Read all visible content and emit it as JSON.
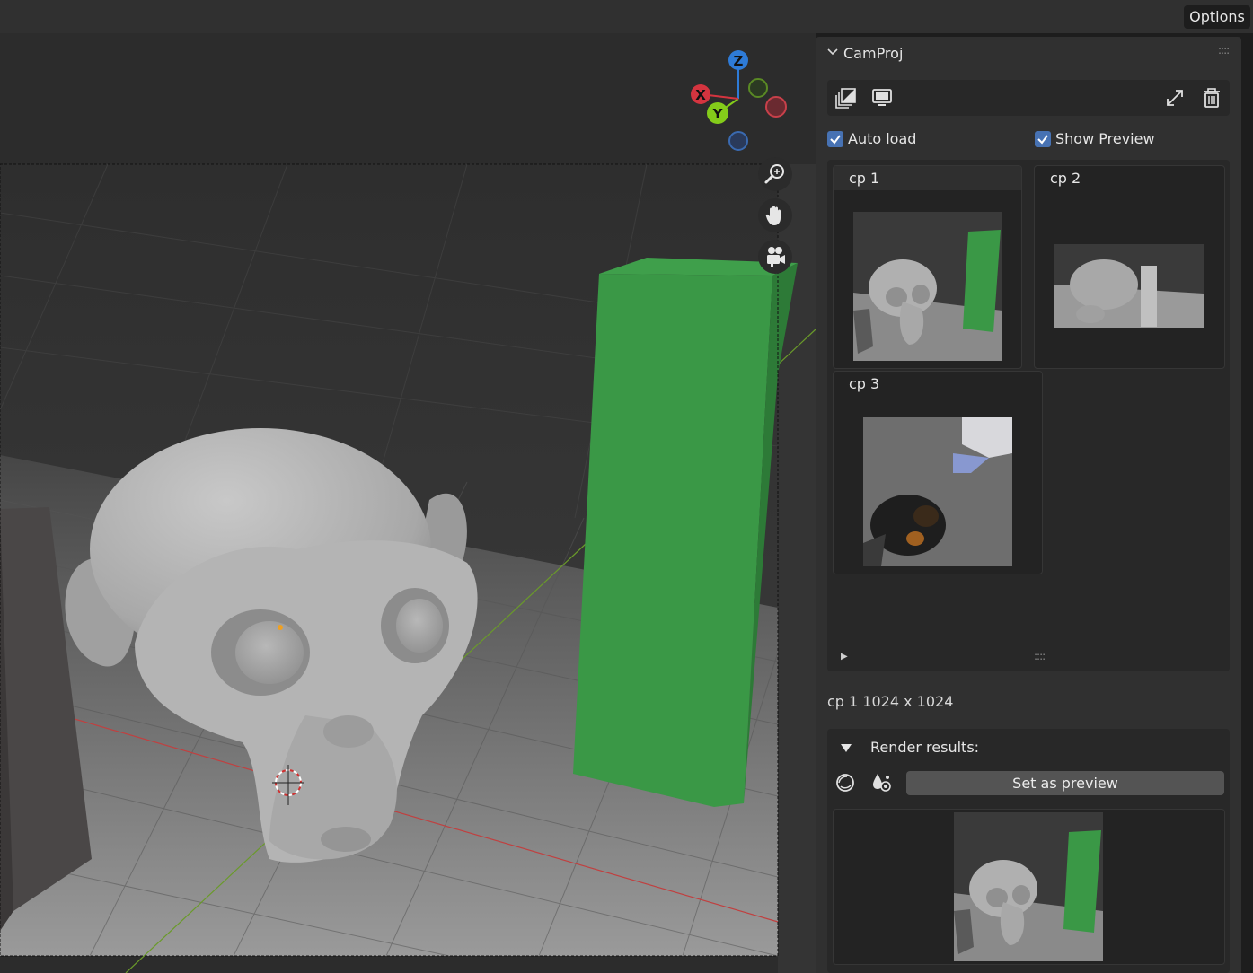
{
  "header": {
    "options_label": "Options"
  },
  "viewport": {
    "gizmo": {
      "x_label": "X",
      "y_label": "Y",
      "z_label": "Z"
    },
    "nav_icons": [
      "zoom-icon",
      "hand-pan-icon",
      "camera-icon"
    ]
  },
  "panel": {
    "title": "CamProj",
    "toolbar_icons": [
      "image-layers-icon",
      "monitor-icon",
      "swap-arrows-icon",
      "trash-icon"
    ],
    "auto_load": {
      "label": "Auto load",
      "checked": true
    },
    "show_preview": {
      "label": "Show Preview",
      "checked": true
    },
    "thumbnails": [
      {
        "label": "cp 1",
        "active": true
      },
      {
        "label": "cp 2",
        "active": false
      },
      {
        "label": "cp 3",
        "active": false
      }
    ],
    "info": "cp 1 1024 x 1024",
    "render_results": {
      "title": "Render results:",
      "icons": [
        "render-sphere-icon",
        "render-material-icon"
      ],
      "set_preview_label": "Set as preview"
    }
  },
  "colors": {
    "accent": "#4772b3",
    "green_box": "#3b9a48",
    "axis_x": "#d4343f",
    "axis_y": "#84cc1a",
    "axis_z": "#2e7bd7"
  }
}
